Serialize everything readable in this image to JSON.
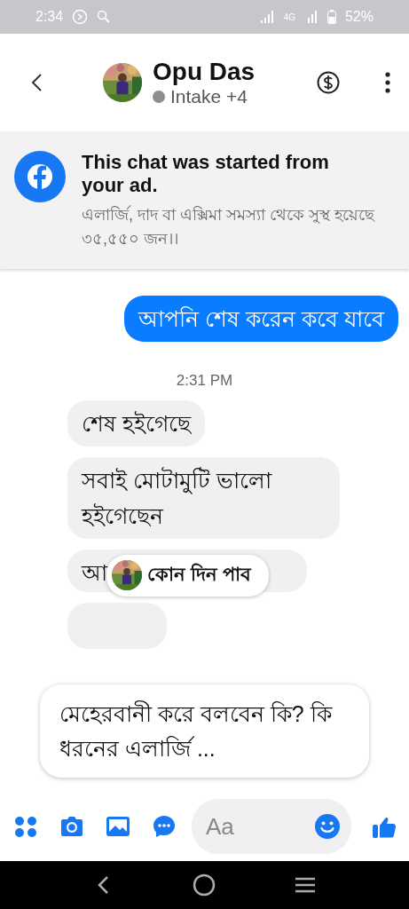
{
  "status_bar": {
    "time": "2:34",
    "network": "4G",
    "battery": "52%"
  },
  "header": {
    "name": "Opu Das",
    "status": "Intake +4",
    "online": false
  },
  "ad_banner": {
    "title": "This chat was started from your ad.",
    "text": "এলার্জি, দাদ বা এক্সিমা সমস্যা থেকে সুস্থ হয়েছে ৩৫,৫৫০ জন।।"
  },
  "messages": [
    {
      "kind": "sent",
      "text": "আপনি শেষ করেন কবে যাবে"
    },
    {
      "kind": "time",
      "text": "2:31 PM"
    },
    {
      "kind": "received",
      "text": "শেষ হইগেছে"
    },
    {
      "kind": "received",
      "text": "সবাই মোটামুটি ভালো হইগেছেন"
    },
    {
      "kind": "received",
      "text": "আ",
      "reply_chip": {
        "text": "কোন দিন পাব"
      }
    },
    {
      "kind": "received_cut"
    }
  ],
  "suggestion": {
    "text": "মেহেরবানী করে বলবেন কি? কি ধরনের এলার্জি ..."
  },
  "composer": {
    "placeholder": "Aa"
  }
}
